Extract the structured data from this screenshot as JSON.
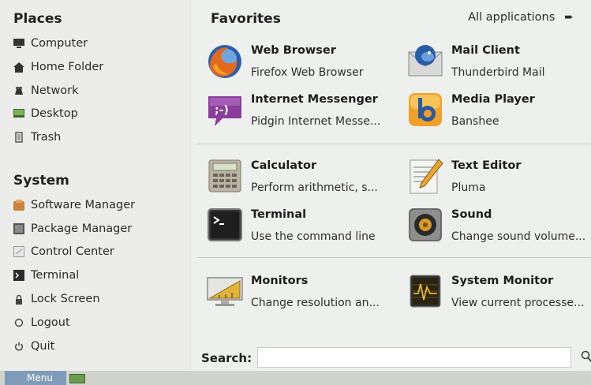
{
  "left": {
    "places_title": "Places",
    "places": [
      {
        "label": "Computer",
        "icon": "computer-icon"
      },
      {
        "label": "Home Folder",
        "icon": "home-icon"
      },
      {
        "label": "Network",
        "icon": "network-icon"
      },
      {
        "label": "Desktop",
        "icon": "desktop-icon"
      },
      {
        "label": "Trash",
        "icon": "trash-icon"
      }
    ],
    "system_title": "System",
    "system": [
      {
        "label": "Software Manager",
        "icon": "software-manager-icon"
      },
      {
        "label": "Package Manager",
        "icon": "package-manager-icon"
      },
      {
        "label": "Control Center",
        "icon": "control-center-icon"
      },
      {
        "label": "Terminal",
        "icon": "terminal-small-icon"
      },
      {
        "label": "Lock Screen",
        "icon": "lock-icon"
      },
      {
        "label": "Logout",
        "icon": "logout-icon"
      },
      {
        "label": "Quit",
        "icon": "quit-icon"
      }
    ]
  },
  "favorites": {
    "title": "Favorites",
    "all_apps": "All applications",
    "apps": [
      {
        "name": "Web Browser",
        "desc": "Firefox Web Browser",
        "icon": "firefox-icon"
      },
      {
        "name": "Mail Client",
        "desc": "Thunderbird Mail",
        "icon": "thunderbird-icon"
      },
      {
        "name": "Internet Messenger",
        "desc": "Pidgin Internet Messe...",
        "icon": "pidgin-icon"
      },
      {
        "name": "Media Player",
        "desc": "Banshee",
        "icon": "banshee-icon"
      },
      {
        "name": "Calculator",
        "desc": "Perform arithmetic, s...",
        "icon": "calculator-icon"
      },
      {
        "name": "Text Editor",
        "desc": "Pluma",
        "icon": "text-editor-icon"
      },
      {
        "name": "Terminal",
        "desc": "Use the command line",
        "icon": "terminal-icon"
      },
      {
        "name": "Sound",
        "desc": "Change sound volume...",
        "icon": "sound-icon"
      },
      {
        "name": "Monitors",
        "desc": "Change resolution an...",
        "icon": "monitors-icon"
      },
      {
        "name": "System Monitor",
        "desc": "View current processe...",
        "icon": "system-monitor-icon"
      }
    ]
  },
  "search": {
    "label": "Search:",
    "value": "",
    "placeholder": ""
  },
  "taskbar": {
    "menu_label": "Menu"
  }
}
